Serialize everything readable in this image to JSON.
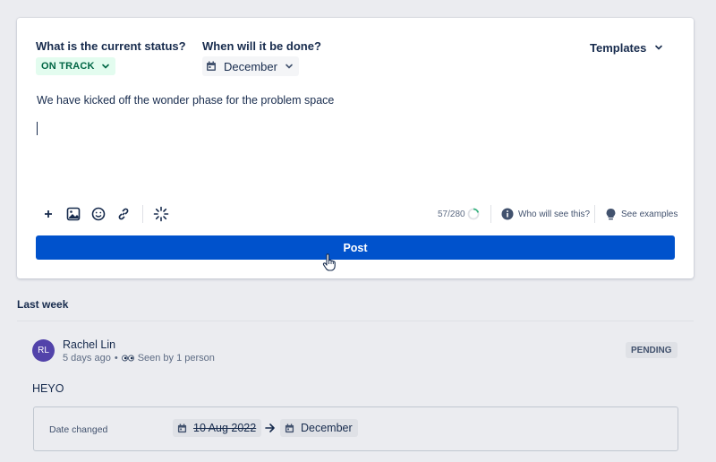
{
  "composer": {
    "status_label": "What is the current status?",
    "status_value": "ON TRACK",
    "due_label": "When will it be done?",
    "due_value": "December",
    "templates_label": "Templates",
    "editor_text": "We have kicked off the wonder phase for the problem space",
    "char_count": "57/280",
    "char_progress": 0.2,
    "who_will_see": "Who will see this?",
    "see_examples": "See examples",
    "post_label": "Post",
    "colors": {
      "accent": "#0052cc",
      "on_track_bg": "#e3fcef",
      "on_track_text": "#006644"
    },
    "toolbar_icons": [
      "plus-icon",
      "image-icon",
      "emoji-icon",
      "link-icon",
      "ai-sparkle-icon"
    ]
  },
  "feed": {
    "section_title": "Last week",
    "update": {
      "avatar_initials": "RL",
      "author": "Rachel Lin",
      "time_ago": "5 days ago",
      "seen_by": "Seen by 1 person",
      "status": "PENDING",
      "text": "HEYO",
      "change": {
        "label": "Date changed",
        "old_date": "10 Aug 2022",
        "new_date": "December"
      }
    }
  }
}
